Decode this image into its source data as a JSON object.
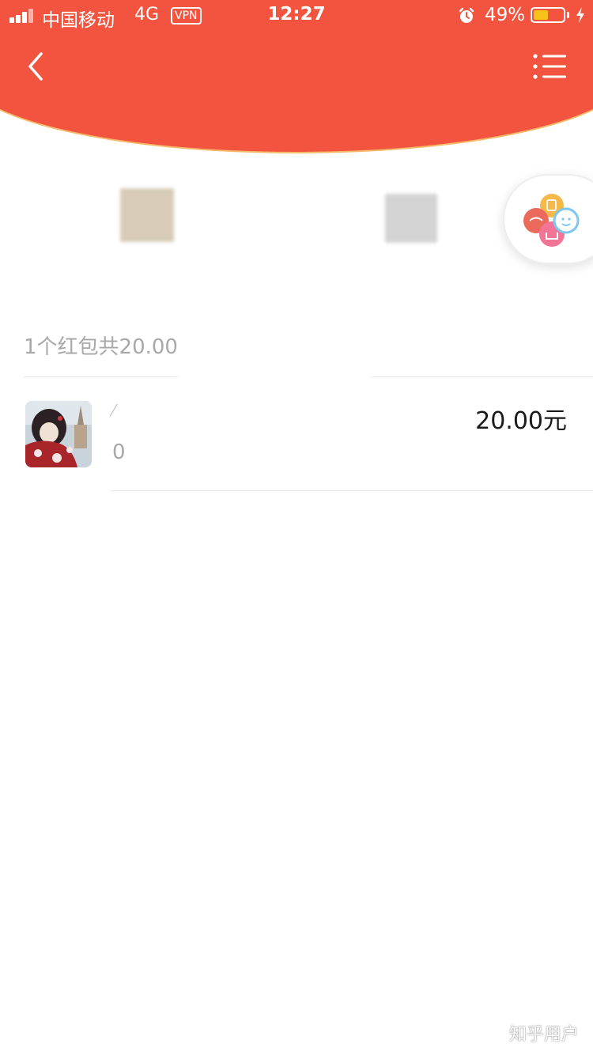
{
  "status_bar": {
    "carrier": "中国移动",
    "network": "4G",
    "vpn": "VPN",
    "time": "12:27",
    "battery": "49%",
    "battery_level": 0.49
  },
  "header": {
    "back_icon": "chevron-left-icon",
    "menu_icon": "list-menu-icon",
    "background_color": "#f2543f"
  },
  "summary": {
    "text": "1个红包共20.00"
  },
  "records": [
    {
      "name": "⁄",
      "time": "0",
      "amount": "20.00元"
    }
  ],
  "watermark": "知乎用户"
}
